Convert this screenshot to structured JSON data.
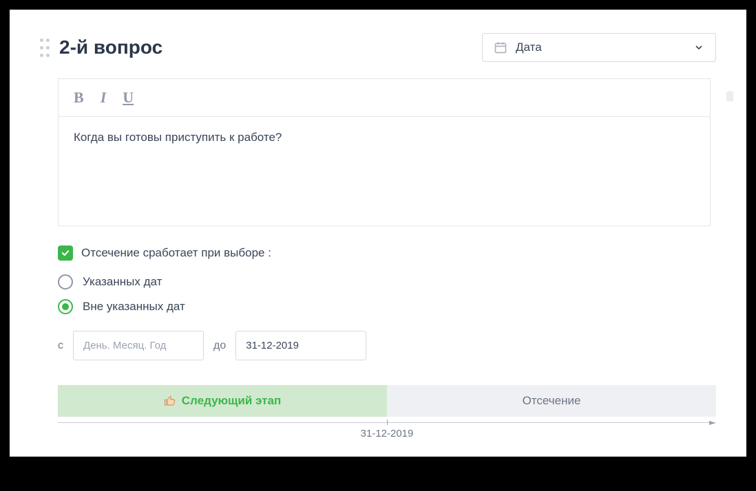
{
  "header": {
    "title": "2-й вопрос",
    "type_selector": {
      "label": "Дата"
    }
  },
  "editor": {
    "bold": "B",
    "italic": "I",
    "underline": "U",
    "question_text": "Когда вы готовы приступить к работе?"
  },
  "cutoff": {
    "checkbox_label": "Отсечение сработает при выборе :",
    "options": {
      "within": "Указанных дат",
      "outside": "Вне указанных дат"
    },
    "dates": {
      "from_label": "с",
      "to_label": "до",
      "from_placeholder": "День. Месяц. Год",
      "from_value": "",
      "to_value": "31-12-2019"
    }
  },
  "segments": {
    "next_stage": "Следующий этап",
    "cutoff": "Отсечение",
    "timeline_label": "31-12-2019"
  }
}
